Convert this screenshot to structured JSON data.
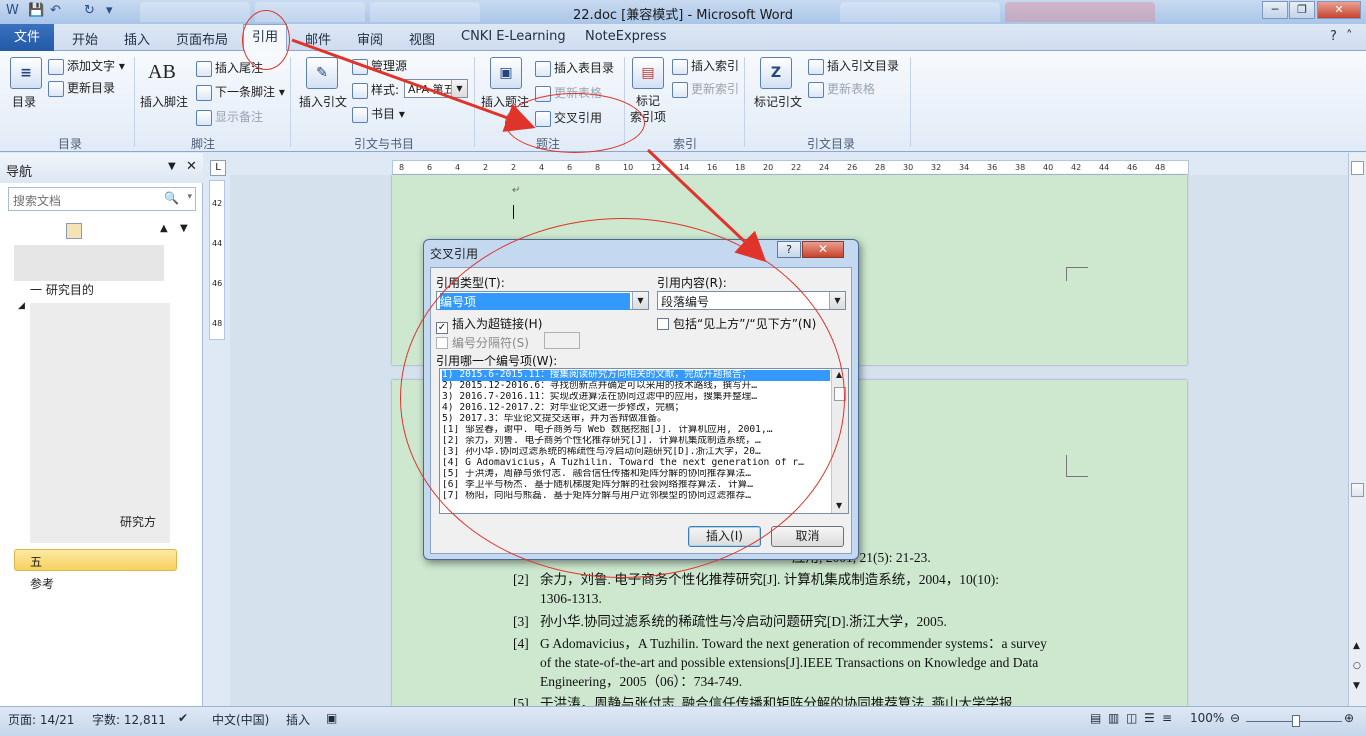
{
  "window": {
    "title": "22.doc [兼容模式] - Microsoft Word",
    "controls": {
      "minimize": "─",
      "maximize": "❐",
      "close": "✕"
    }
  },
  "ribbon_tabs": {
    "file": "文件",
    "home": "开始",
    "insert": "插入",
    "layout": "页面布局",
    "references": "引用",
    "mailings": "邮件",
    "review": "审阅",
    "view": "视图",
    "cnki": "CNKI E-Learning",
    "noteexpress": "NoteExpress"
  },
  "ribbon": {
    "toc": {
      "button": "目录",
      "add_text": "添加文字",
      "update": "更新目录",
      "group": "目录"
    },
    "footnotes": {
      "insert_footnote": "插入脚注",
      "insert_endnote": "插入尾注",
      "next_footnote": "下一条脚注",
      "show_notes": "显示备注",
      "group": "脚注",
      "ab_label": "AB"
    },
    "citations": {
      "insert_citation": "插入引文",
      "manage_sources": "管理源",
      "style_label": "样式:",
      "style_value": "APA 第五",
      "bibliography": "书目",
      "group": "引文与书目"
    },
    "captions": {
      "insert_caption": "插入题注",
      "insert_table_of_figures": "插入表目录",
      "update_table": "更新表格",
      "cross_reference": "交叉引用",
      "group": "题注"
    },
    "index": {
      "mark_entry": "标记\n索引项",
      "insert_index": "插入索引",
      "update_index": "更新索引",
      "group": "索引"
    },
    "authorities": {
      "mark_citation": "标记引文",
      "insert_table": "插入引文目录",
      "update_table": "更新表格",
      "group": "引文目录"
    }
  },
  "nav": {
    "title": "导航",
    "search_placeholder": "搜索文档",
    "items": [
      "一 研究目的",
      "研究方",
      "五",
      "参考"
    ]
  },
  "ruler": {
    "h_ticks": [
      "8",
      "6",
      "4",
      "2",
      "2",
      "4",
      "6",
      "8",
      "10",
      "12",
      "14",
      "16",
      "18",
      "20",
      "22",
      "24",
      "26",
      "28",
      "30",
      "32",
      "34",
      "36",
      "38",
      "40",
      "42",
      "44",
      "46",
      "48"
    ],
    "v_ticks": [
      "42",
      "44",
      "46",
      "48"
    ]
  },
  "document": {
    "refs": [
      {
        "num": "[2]",
        "lines": [
          "余力，刘鲁. 电子商务个性化推荐研究[J]. 计算机集成制造系统，2004，10(10):",
          "1306-1313."
        ]
      },
      {
        "num": "[3]",
        "lines": [
          "孙小华.协同过滤系统的稀疏性与冷启动问题研究[D].浙江大学，2005."
        ]
      },
      {
        "num": "[4]",
        "lines": [
          "G Adomavicius，A Tuzhilin. Toward the next generation of recommender systems：a survey",
          "of the state-of-the-art and possible extensions[J].IEEE Transactions on Knowledge and Data",
          "Engineering，2005（06）：734-749."
        ]
      },
      {
        "num": "[5]",
        "lines": [
          "于洪涛，周静与张付志. 融合信任传播和矩阵分解的协同推荐算法. 燕山大学学报"
        ]
      }
    ],
    "partial_line": "应用, 2001, 21(5): 21-23."
  },
  "dialog": {
    "title": "交叉引用",
    "help": "?",
    "close": "✕",
    "ref_type_label": "引用类型(T):",
    "ref_type_value": "编号项",
    "ref_content_label": "引用内容(R):",
    "ref_content_value": "段落编号",
    "insert_hyperlink": "插入为超链接(H)",
    "include_above_below": "包括“见上方”/“见下方”(N)",
    "separator_label": "编号分隔符(S)",
    "which_label": "引用哪一个编号项(W):",
    "items": [
      "1) 2015.6-2015.11：搜集阅读研究方向相关的文献，完成开题报告；",
      "2) 2015.12-2016.6：寻找创新点并确定可以采用的技术路线，撰写开…",
      "3) 2016.7-2016.11：实现改进算法在协同过滤中的应用，搜集并整理…",
      "4) 2016.12-2017.2：对毕业论文进一步修改，完稿；",
      "5) 2017.3：毕业论文提交送审，并为答辩做准备。",
      "[1] 邹昱春，谢中. 电子商务与 Web 数据挖掘[J]. 计算机应用, 2001,…",
      "[2] 余力，刘鲁. 电子商务个性化推荐研究[J]. 计算机集成制造系统，…",
      "[3] 孙小华.协同过滤系统的稀疏性与冷启动问题研究[D].浙江大学，20…",
      "[4] G Adomavicius，A Tuzhilin. Toward the next generation of r…",
      "[5] 于洪涛，周静与张付志. 融合信任传播和矩阵分解的协同推荐算法…",
      "[6] 李卫平与杨杰. 基于随机梯度矩阵分解的社会网络推荐算法. 计算…",
      "[7] 杨阳，向阳与熊磊. 基于矩阵分解与用户近邻模型的协同过滤推荐…"
    ],
    "insert_button": "插入(I)",
    "cancel_button": "取消"
  },
  "status": {
    "page": "页面: 14/21",
    "words": "字数: 12,811",
    "language": "中文(中国)",
    "mode": "插入",
    "zoom": "100%"
  },
  "colors": {
    "annotation": "#e0342a",
    "page_bg": "#cde8cf",
    "selection": "#3399ff"
  }
}
